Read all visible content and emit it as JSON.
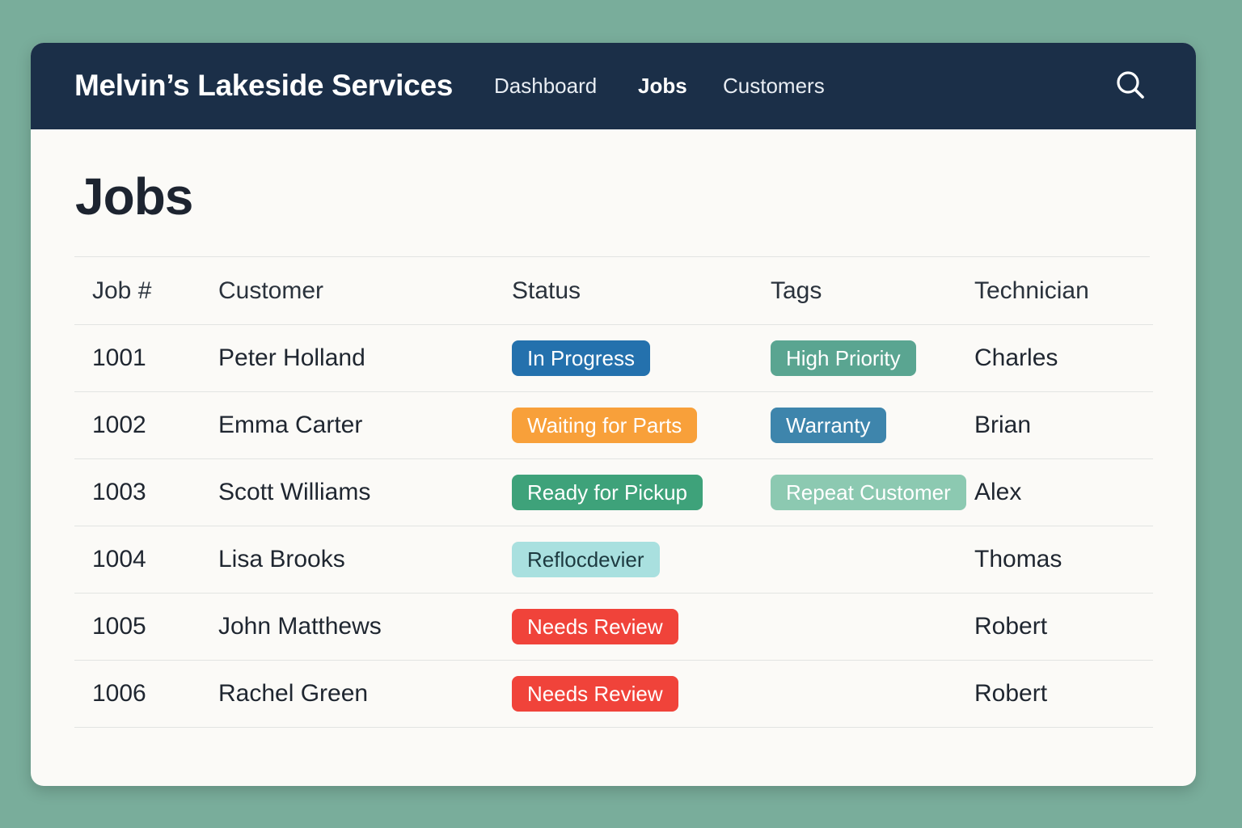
{
  "header": {
    "brand": "Melvin’s Lakeside Services",
    "nav": [
      {
        "label": "Dashboard",
        "active": false
      },
      {
        "label": "Jobs",
        "active": true
      },
      {
        "label": "Customers",
        "active": false
      }
    ],
    "search_icon": "search-icon"
  },
  "page": {
    "title": "Jobs"
  },
  "table": {
    "columns": [
      "Job #",
      "Customer",
      "Status",
      "Tags",
      "Technician"
    ],
    "rows": [
      {
        "job": "1001",
        "customer": "Peter Holland",
        "status": "In Progress",
        "status_color": "#2471ad",
        "status_text_color": "#ffffff",
        "tag": "High Priority",
        "tag_color": "#5aa591",
        "tag_text_color": "#ffffff",
        "technician": "Charles"
      },
      {
        "job": "1002",
        "customer": "Emma Carter",
        "status": "Waiting for Parts",
        "status_color": "#f8a03a",
        "status_text_color": "#ffffff",
        "tag": "Warranty",
        "tag_color": "#3e85ac",
        "tag_text_color": "#ffffff",
        "technician": "Brian"
      },
      {
        "job": "1003",
        "customer": "Scott Williams",
        "status": "Ready for Pickup",
        "status_color": "#3ea27a",
        "status_text_color": "#ffffff",
        "tag": "Repeat Customer",
        "tag_color": "#8cc9b1",
        "tag_text_color": "#ffffff",
        "technician": "Alex"
      },
      {
        "job": "1004",
        "customer": "Lisa Brooks",
        "status": "Reflocdevier",
        "status_color": "#a9e0df",
        "status_text_color": "#1d3a40",
        "tag": "",
        "tag_color": "",
        "tag_text_color": "",
        "technician": "Thomas"
      },
      {
        "job": "1005",
        "customer": "John Matthews",
        "status": "Needs Review",
        "status_color": "#f0433a",
        "status_text_color": "#ffffff",
        "tag": "",
        "tag_color": "",
        "tag_text_color": "",
        "technician": "Robert"
      },
      {
        "job": "1006",
        "customer": "Rachel Green",
        "status": "Needs Review",
        "status_color": "#f0433a",
        "status_text_color": "#ffffff",
        "tag": "",
        "tag_color": "",
        "tag_text_color": "",
        "technician": "Robert"
      }
    ]
  }
}
